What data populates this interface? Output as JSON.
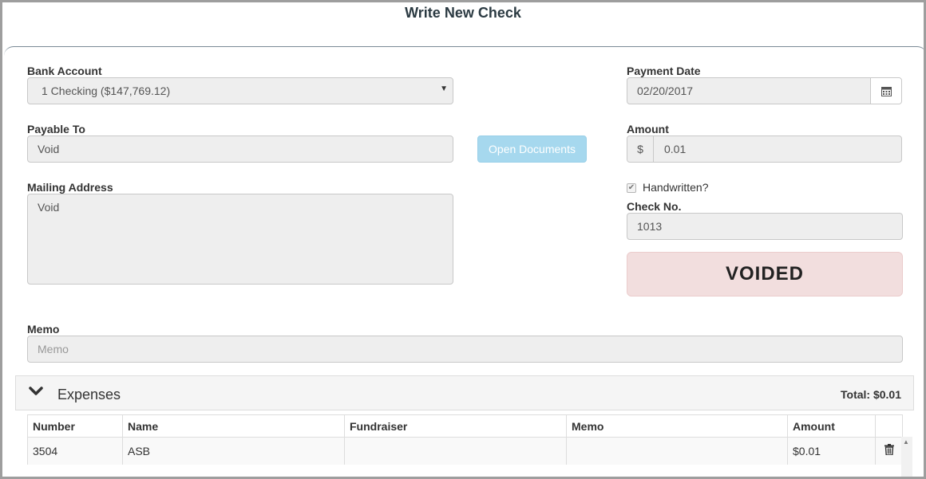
{
  "window": {
    "title": "Write New Check"
  },
  "bank_account": {
    "label": "Bank Account",
    "value": "1 Checking ($147,769.12)"
  },
  "payment_date": {
    "label": "Payment Date",
    "value": "02/20/2017"
  },
  "payable_to": {
    "label": "Payable To",
    "value": "Void"
  },
  "open_documents": {
    "label": "Open Documents"
  },
  "amount": {
    "label": "Amount",
    "currency": "$",
    "value": "0.01"
  },
  "mailing_address": {
    "label": "Mailing Address",
    "value": "Void"
  },
  "handwritten": {
    "label": "Handwritten?",
    "checked": true
  },
  "check_no": {
    "label": "Check No.",
    "value": "1013"
  },
  "status": {
    "label": "VOIDED",
    "color": "#f2dede"
  },
  "memo": {
    "label": "Memo",
    "placeholder": "Memo"
  },
  "expenses": {
    "title": "Expenses",
    "total": "Total: $0.01",
    "columns": [
      "Number",
      "Name",
      "Fundraiser",
      "Memo",
      "Amount"
    ],
    "rows": [
      {
        "number": "3504",
        "name": "ASB",
        "fundraiser": "",
        "memo": "",
        "amount": "$0.01"
      }
    ]
  },
  "icons": {
    "calendar": "calendar-icon",
    "trash": "trash-icon",
    "chevron": "chevron-down-icon",
    "caret": "caret-down-icon"
  }
}
